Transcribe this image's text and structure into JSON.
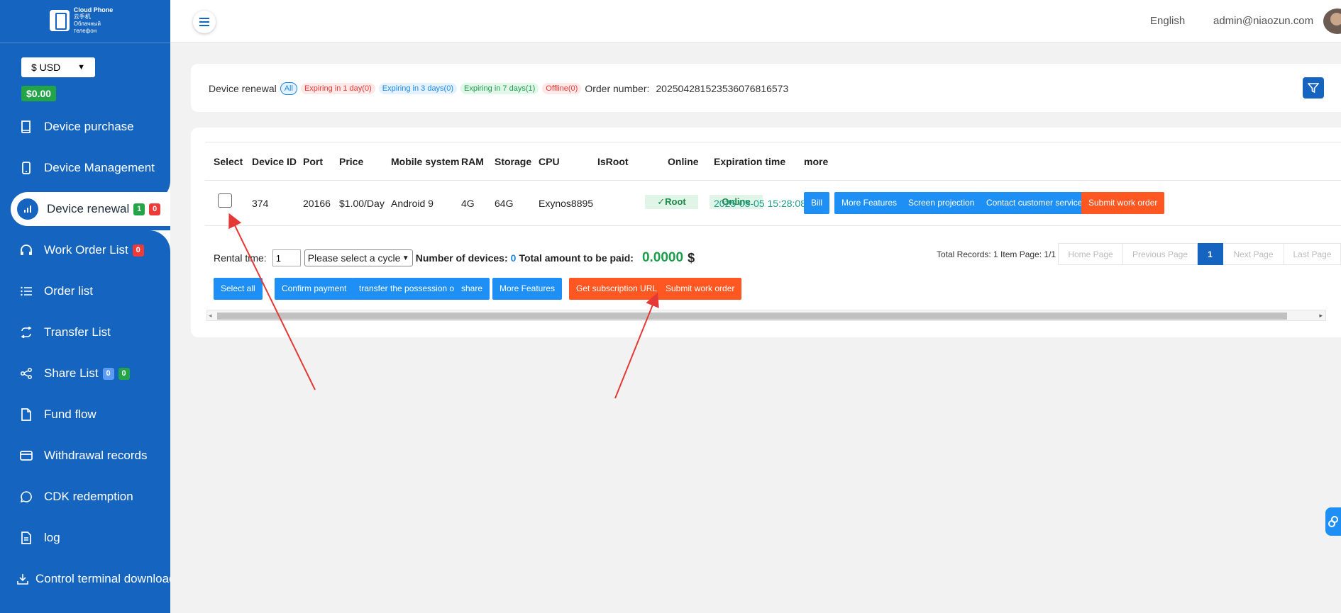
{
  "brand": {
    "line1": "Cloud Phone",
    "line2": "云手机",
    "line3": "Облачный телефон"
  },
  "sidebar": {
    "currency": "$ USD",
    "balance": "$0.00",
    "items": [
      {
        "label": "Device purchase",
        "icon": "book-icon"
      },
      {
        "label": "Device Management",
        "icon": "phone-icon"
      },
      {
        "label": "Device renewal",
        "icon": "bar-chart-icon",
        "badges": [
          "1",
          "0"
        ]
      },
      {
        "label": "Work Order List",
        "icon": "headset-icon",
        "badges": [
          "0"
        ]
      },
      {
        "label": "Order list",
        "icon": "list-icon"
      },
      {
        "label": "Transfer List",
        "icon": "transfer-icon"
      },
      {
        "label": "Share List",
        "icon": "share-icon",
        "badges": [
          "0",
          "0"
        ]
      },
      {
        "label": "Fund flow",
        "icon": "document-icon"
      },
      {
        "label": "Withdrawal records",
        "icon": "card-icon"
      },
      {
        "label": "CDK redemption",
        "icon": "chat-icon"
      },
      {
        "label": "log",
        "icon": "file-icon"
      },
      {
        "label": "Control terminal download",
        "icon": "download-icon"
      }
    ]
  },
  "header": {
    "language": "English",
    "user": "admin@niaozun.com"
  },
  "filter": {
    "label": "Device renewal",
    "tags": [
      "All",
      "Expiring in 1 day(0)",
      "Expiring in 3 days(0)",
      "Expiring in 7 days(1)",
      "Offline(0)"
    ],
    "order_label": "Order number:",
    "order_number": "20250428152353607681​6573"
  },
  "table": {
    "columns": [
      "Select",
      "Device ID",
      "Port",
      "Price",
      "Mobile system",
      "RAM",
      "Storage",
      "CPU",
      "IsRoot",
      "Online",
      "Expiration time",
      "more"
    ],
    "row": {
      "device_id": "374",
      "port": "20166",
      "price": "$1.00/Day",
      "system": "Android 9",
      "ram": "4G",
      "storage": "64G",
      "cpu": "Exynos8895",
      "root": "✓Root",
      "online": "Online",
      "expiration": "2025-05-05 15:28:08",
      "actions": [
        "Bill",
        "More Features",
        "Screen projection",
        "Contact customer service",
        "Submit work order"
      ]
    }
  },
  "rental": {
    "label": "Rental time:",
    "value": "1",
    "cycle_placeholder": "Please select a cycle",
    "devices_label": "Number of devices:",
    "devices_count": "0",
    "total_label": "Total amount to be paid:",
    "total": "0.0000",
    "currency_symbol": "$"
  },
  "pager": {
    "info": "Total Records: 1 Item Page: 1/1",
    "home": "Home Page",
    "prev": "Previous Page",
    "current": "1",
    "next": "Next Page",
    "last": "Last Page"
  },
  "actions": [
    "Select all",
    "Confirm payment",
    "transfer the possession of",
    "share",
    "More Features",
    "Get subscription URL",
    "Submit work order"
  ],
  "colors": {
    "sidebar": "#1565c0",
    "primary_button": "#1e90f5",
    "danger_button": "#ff5722",
    "success": "#22a447"
  }
}
